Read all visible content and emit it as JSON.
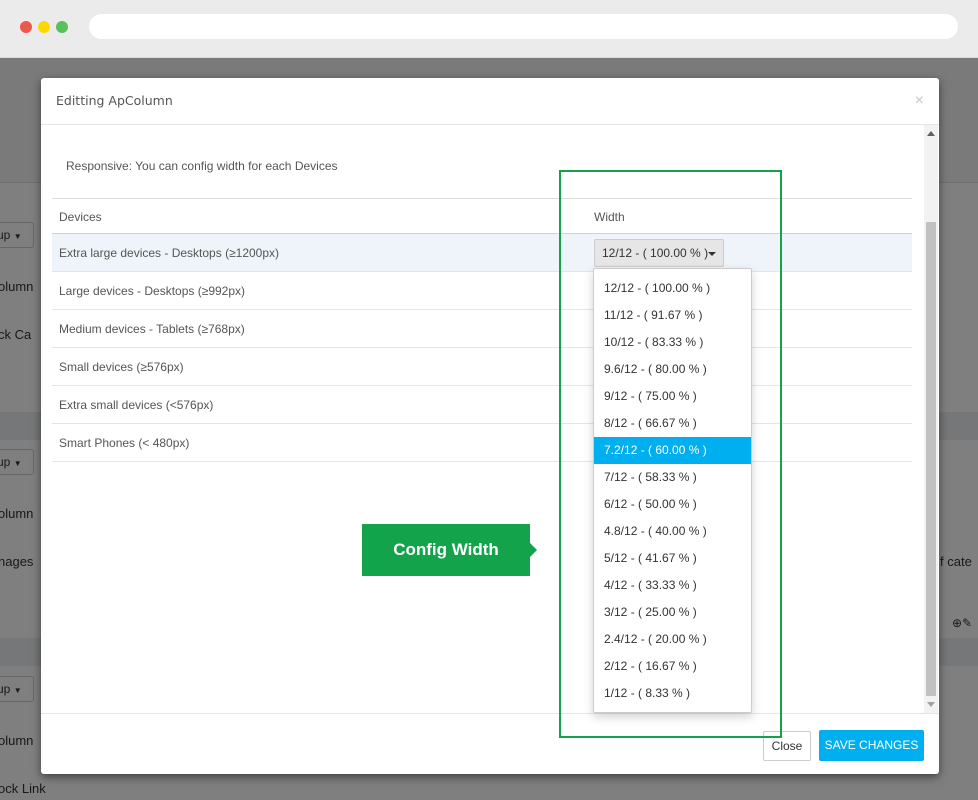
{
  "background": {
    "items": [
      {
        "name": "bg-group-dropdown-1",
        "text": "up",
        "type": "button"
      },
      {
        "name": "bg-text-column-1",
        "text": "olumn"
      },
      {
        "name": "bg-text-block-ca",
        "text": "ck Ca"
      },
      {
        "name": "bg-group-dropdown-2",
        "text": "up",
        "type": "button"
      },
      {
        "name": "bg-text-column-2",
        "text": "olumn"
      },
      {
        "name": "bg-text-images",
        "text": "nages"
      },
      {
        "name": "bg-text-categories",
        "text": "f cate"
      },
      {
        "name": "bg-group-dropdown-3",
        "text": "up",
        "type": "button"
      },
      {
        "name": "bg-text-column-3",
        "text": "olumn"
      },
      {
        "name": "bg-text-block-link",
        "text": "ock Link"
      }
    ]
  },
  "modal": {
    "title": "Editting ApColumn",
    "close_glyph": "×",
    "intro": "Responsive: You can config width for each Devices",
    "table": {
      "headers": {
        "devices": "Devices",
        "width": "Width"
      },
      "rows": [
        {
          "device": "Extra large devices - Desktops (≥1200px)",
          "width_value": "12/12 - ( 100.00 % )"
        },
        {
          "device": "Large devices - Desktops (≥992px)"
        },
        {
          "device": "Medium devices - Tablets (≥768px)"
        },
        {
          "device": "Small devices (≥576px)"
        },
        {
          "device": "Extra small devices (<576px)"
        },
        {
          "device": "Smart Phones (< 480px)"
        }
      ]
    },
    "dropdown": {
      "options": [
        "12/12 - ( 100.00 % )",
        "11/12 - ( 91.67 % )",
        "10/12 - ( 83.33 % )",
        "9.6/12 - ( 80.00 % )",
        "9/12 - ( 75.00 % )",
        "8/12 - ( 66.67 % )",
        "7.2/12 - ( 60.00 % )",
        "7/12 - ( 58.33 % )",
        "6/12 - ( 50.00 % )",
        "4.8/12 - ( 40.00 % )",
        "5/12 - ( 41.67 % )",
        "4/12 - ( 33.33 % )",
        "3/12 - ( 25.00 % )",
        "2.4/12 - ( 20.00 % )",
        "2/12 - ( 16.67 % )",
        "1/12 - ( 8.33 % )"
      ],
      "highlighted": "7.2/12 - ( 60.00 % )"
    },
    "footer": {
      "close_label": "Close",
      "save_label": "SAVE CHANGES"
    }
  },
  "annotation": {
    "callout_text": "Config Width",
    "color": "#13a34a"
  },
  "colors": {
    "accent": "#00aff0",
    "annotation": "#13a34a"
  }
}
